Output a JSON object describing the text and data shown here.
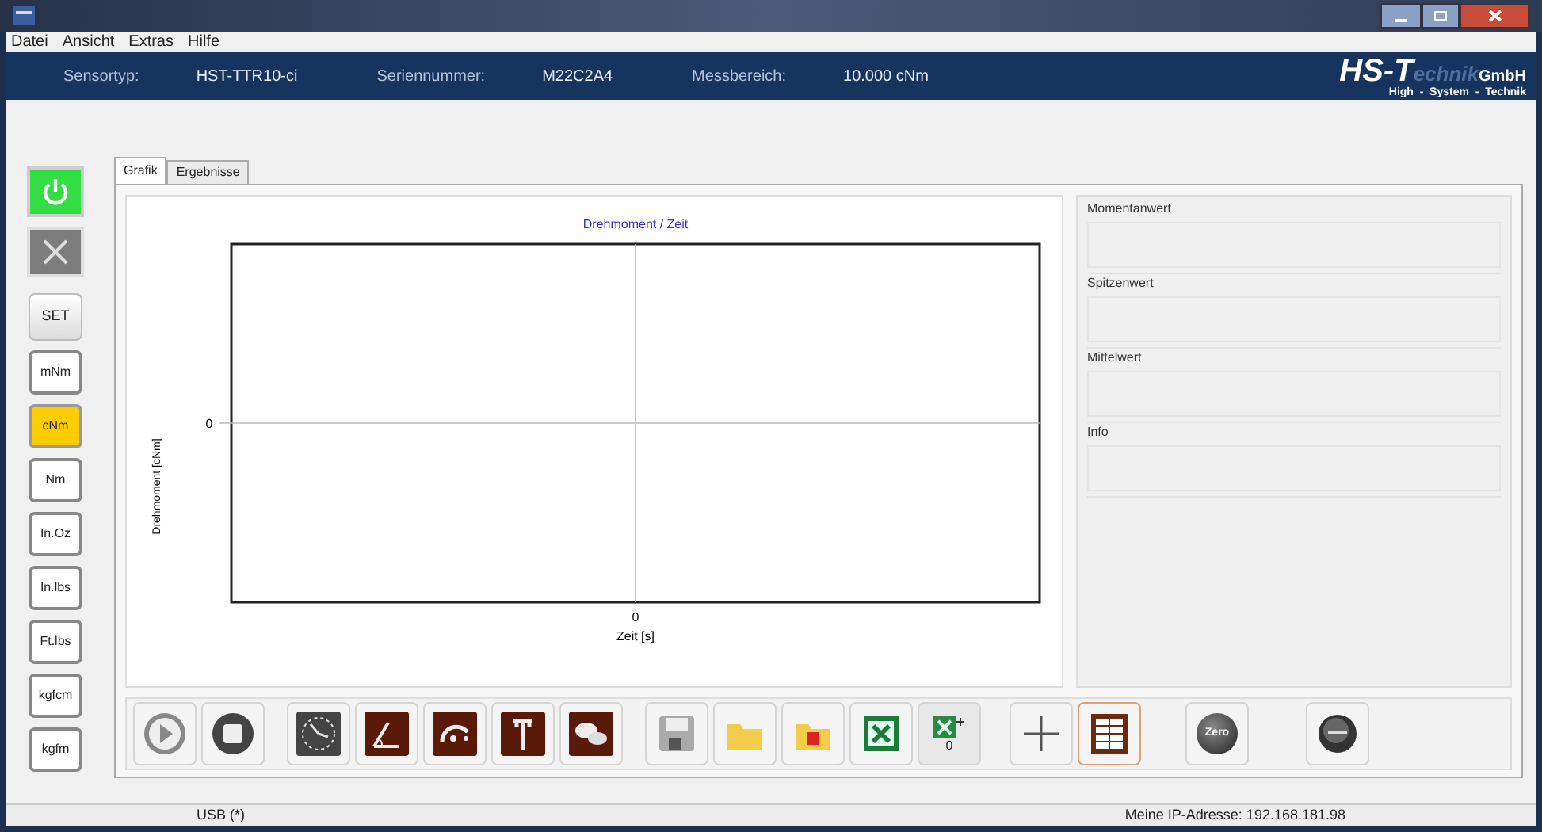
{
  "menu": [
    "Datei",
    "Ansicht",
    "Extras",
    "Hilfe"
  ],
  "header": {
    "fields": [
      {
        "label": "Sensortyp:",
        "value": "HST-TTR10-ci"
      },
      {
        "label": "Seriennummer:",
        "value": "M22C2A4"
      },
      {
        "label": "Messbereich:",
        "value": "10.000 cNm"
      }
    ],
    "logo": {
      "mark": "HS-T",
      "word": "echnik",
      "suffix": "GmbH",
      "tagline": "High  -  System  -  Technik"
    }
  },
  "power": {
    "on": true
  },
  "set_button": "SET",
  "units": [
    {
      "label": "mNm",
      "selected": false
    },
    {
      "label": "cNm",
      "selected": true
    },
    {
      "label": "Nm",
      "selected": false
    },
    {
      "label": "In.Oz",
      "selected": false
    },
    {
      "label": "In.lbs",
      "selected": false
    },
    {
      "label": "Ft.lbs",
      "selected": false
    },
    {
      "label": "kgfcm",
      "selected": false
    },
    {
      "label": "kgfm",
      "selected": false
    }
  ],
  "tabs": [
    {
      "label": "Grafik",
      "selected": true
    },
    {
      "label": "Ergebnisse",
      "selected": false
    }
  ],
  "chart": {
    "title": "Drehmoment / Zeit",
    "xlabel": "Zeit [s]",
    "ylabel": "Drehmoment [cNm]",
    "x_tick": "0",
    "y_tick": "0"
  },
  "results": [
    "Momentanwert",
    "Spitzenwert",
    "Mittelwert",
    "Info"
  ],
  "toolbar": {
    "export_count": "0",
    "zero_label": "Zero"
  },
  "status_bar": {
    "connection": "USB (*)",
    "ip": "Meine IP-Adresse: 192.168.181.98"
  }
}
